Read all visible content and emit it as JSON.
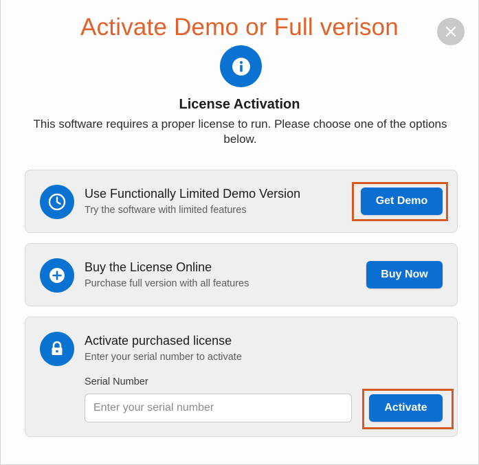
{
  "annotation": {
    "title": "Activate Demo or Full verison"
  },
  "dialog": {
    "heading": "License Activation",
    "subtitle": "This software requires a proper license to run. Please choose one of the options below."
  },
  "cards": {
    "demo": {
      "title": "Use Functionally Limited Demo Version",
      "description": "Try the software with limited features",
      "button": "Get Demo",
      "icon": "clock-icon"
    },
    "buy": {
      "title": "Buy the License Online",
      "description": "Purchase full version with all features",
      "button": "Buy Now",
      "icon": "plus-icon"
    },
    "activate": {
      "title": "Activate purchased license",
      "description": "Enter your serial number to activate",
      "field_label": "Serial Number",
      "field_placeholder": "Enter your serial number",
      "field_value": "",
      "button": "Activate",
      "icon": "lock-icon"
    }
  },
  "colors": {
    "accent": "#0a73d1",
    "annotation": "#e0622a",
    "card_background": "#efefef"
  }
}
